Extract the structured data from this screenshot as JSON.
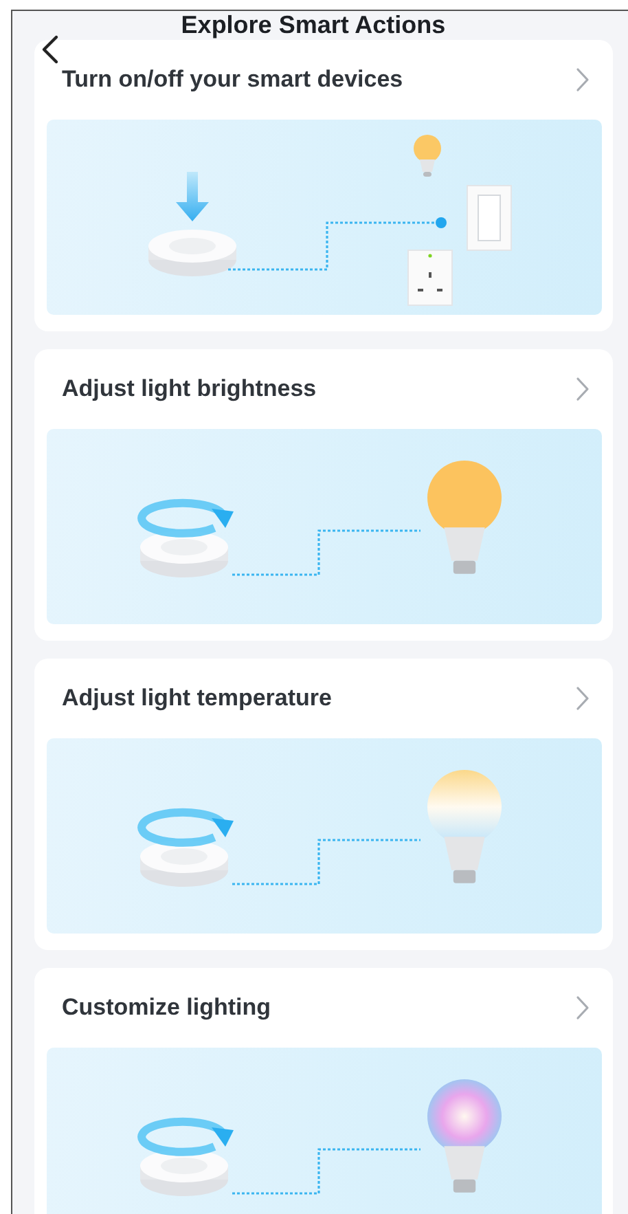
{
  "header": {
    "title": "Explore Smart Actions"
  },
  "actions": [
    {
      "title": "Turn on/off your smart devices",
      "kind": "switch"
    },
    {
      "title": "Adjust light brightness",
      "kind": "brightness"
    },
    {
      "title": "Adjust light temperature",
      "kind": "temperature"
    },
    {
      "title": "Customize lighting",
      "kind": "color"
    }
  ]
}
